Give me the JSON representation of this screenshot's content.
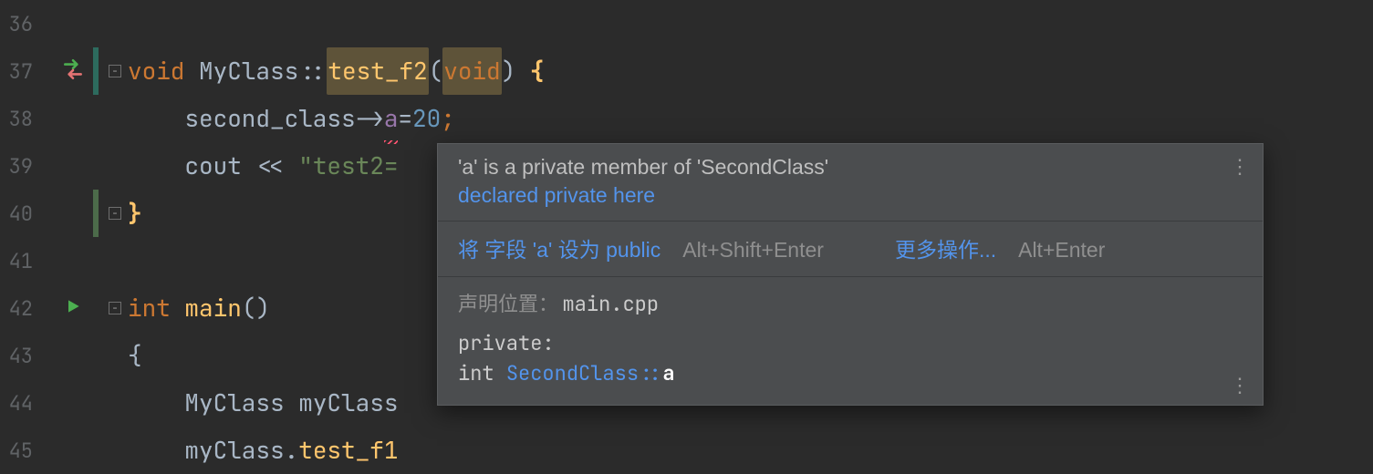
{
  "lines": {
    "l36": "36",
    "l37": "37",
    "l38": "38",
    "l39": "39",
    "l40": "40",
    "l41": "41",
    "l42": "42",
    "l43": "43",
    "l44": "44",
    "l45": "45"
  },
  "code": {
    "l37": {
      "kw_void1": "void",
      "sp": " ",
      "cls": "MyClass",
      "scope": "::",
      "fn": "test_f2",
      "lp": "(",
      "kw_void2": "void",
      "rp": ")",
      "sp2": " ",
      "brace": "{"
    },
    "l38": {
      "indent": "    ",
      "obj": "second_class",
      "arrow": "->",
      "field": "a",
      "eq": "=",
      "num": "20",
      "semi": ";"
    },
    "l39": {
      "indent": "    ",
      "cout": "cout",
      "sp": " ",
      "shl": "<<",
      "sp2": " ",
      "str": "\"test2="
    },
    "l40": {
      "brace": "}"
    },
    "l42": {
      "kw_int": "int",
      "sp": " ",
      "fn": "main",
      "lp": "(",
      "rp": ")"
    },
    "l43": {
      "brace": "{"
    },
    "l44": {
      "indent": "    ",
      "cls": "MyClass",
      "sp": " ",
      "var": "myClass"
    },
    "l45": {
      "indent": "    ",
      "obj": "myClass",
      "dot": ".",
      "fn": "test_f1"
    }
  },
  "popup": {
    "errorMessage": "'a' is a private member of 'SecondClass'",
    "errorLink": "declared private here",
    "quickFix": "将 字段 'a' 设为 public",
    "quickFixShortcut": "Alt+Shift+Enter",
    "moreActions": "更多操作...",
    "moreActionsShortcut": "Alt+Enter",
    "declLabel": "声明位置：",
    "declFile": "main.cpp",
    "declAccess": "private:",
    "declType": "int",
    "declClass": "SecondClass",
    "declScope": "::",
    "declName": "a"
  }
}
